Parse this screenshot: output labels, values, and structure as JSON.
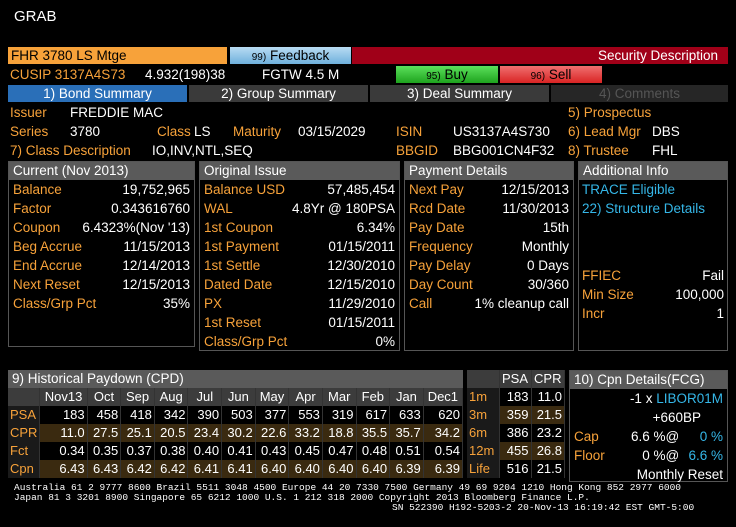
{
  "window": {
    "title": "GRAB"
  },
  "toolbar": {
    "ticker": "FHR 3780 LS Mtge",
    "feedback_num": "99)",
    "feedback_label": "Feedback",
    "security_description": "Security Description"
  },
  "line2": {
    "cusip": "CUSIP 3137A4S73",
    "coupon_info": "4.932(198)38",
    "fgtw": "FGTW 4.5 M",
    "buy_num": "95)",
    "buy_label": "Buy",
    "sell_num": "96)",
    "sell_label": "Sell"
  },
  "tabs": [
    {
      "label": "1) Bond Summary"
    },
    {
      "label": "2) Group Summary"
    },
    {
      "label": "3) Deal Summary"
    },
    {
      "label": "4) Comments"
    }
  ],
  "info": {
    "issuer_label": "Issuer",
    "issuer_value": "FREDDIE MAC",
    "series_label": "Series",
    "series_value": "3780",
    "class_label": "Class",
    "class_value": "LS",
    "maturity_label": "Maturity",
    "maturity_value": "03/15/2029",
    "isin_label": "ISIN",
    "isin_value": "US3137A4S730",
    "class_desc_label": "7) Class Description",
    "class_desc_value": "IO,INV,NTL,SEQ",
    "bbgid_label": "BBGID",
    "bbgid_value": "BBG001CN4F32",
    "prospectus": "5) Prospectus",
    "lead_mgr_label": "6) Lead Mgr",
    "lead_mgr_value": "DBS",
    "trustee_label": "8) Trustee",
    "trustee_value": "FHL"
  },
  "current": {
    "title": "Current (Nov 2013)",
    "rows": [
      {
        "label": "Balance",
        "value": "19,752,965"
      },
      {
        "label": "Factor",
        "value": "0.343616760"
      },
      {
        "label": "Coupon",
        "value": "6.4323%(Nov '13)"
      },
      {
        "label": "Beg Accrue",
        "value": "11/15/2013"
      },
      {
        "label": "End Accrue",
        "value": "12/14/2013"
      },
      {
        "label": "Next Reset",
        "value": "12/15/2013"
      },
      {
        "label": "Class/Grp Pct",
        "value": "35%"
      }
    ]
  },
  "original": {
    "title": "Original Issue",
    "rows": [
      {
        "label": "Balance USD",
        "value": "57,485,454"
      },
      {
        "label": "WAL",
        "value": "4.8Yr @ 180PSA"
      },
      {
        "label": "1st Coupon",
        "value": "6.34%"
      },
      {
        "label": "1st Payment",
        "value": "01/15/2011"
      },
      {
        "label": "1st Settle",
        "value": "12/30/2010"
      },
      {
        "label": "Dated Date",
        "value": "12/15/2010"
      },
      {
        "label": "PX",
        "value": "11/29/2010"
      },
      {
        "label": "1st Reset",
        "value": "01/15/2011"
      },
      {
        "label": "Class/Grp Pct",
        "value": "0%"
      }
    ]
  },
  "payment": {
    "title": "Payment Details",
    "rows": [
      {
        "label": "Next Pay",
        "value": "12/15/2013"
      },
      {
        "label": "Rcd Date",
        "value": "11/30/2013"
      },
      {
        "label": "Pay Date",
        "value": "15th"
      },
      {
        "label": "Frequency",
        "value": "Monthly"
      },
      {
        "label": "Pay Delay",
        "value": "0 Days"
      },
      {
        "label": "Day Count",
        "value": "30/360"
      },
      {
        "label": "Call",
        "value": "1% cleanup call"
      }
    ]
  },
  "additional": {
    "title": "Additional Info",
    "trace": "TRACE Eligible",
    "structure": "22) Structure Details",
    "rows": [
      {
        "label": "FFIEC",
        "value": "Fail"
      },
      {
        "label": "Min Size",
        "value": "100,000"
      },
      {
        "label": "Incr",
        "value": "1"
      }
    ]
  },
  "paydown": {
    "title": "9) Historical Paydown (CPD)",
    "months": [
      "Nov13",
      "Oct",
      "Sep",
      "Aug",
      "Jul",
      "Jun",
      "May",
      "Apr",
      "Mar",
      "Feb",
      "Jan",
      "Dec1"
    ],
    "rows": [
      {
        "label": "PSA",
        "values": [
          "183",
          "458",
          "418",
          "342",
          "390",
          "503",
          "377",
          "553",
          "319",
          "617",
          "633",
          "620"
        ]
      },
      {
        "label": "CPR",
        "values": [
          "11.0",
          "27.5",
          "25.1",
          "20.5",
          "23.4",
          "30.2",
          "22.6",
          "33.2",
          "18.8",
          "35.5",
          "35.7",
          "34.2"
        ]
      },
      {
        "label": "Fct",
        "values": [
          "0.34",
          "0.35",
          "0.37",
          "0.38",
          "0.40",
          "0.41",
          "0.43",
          "0.45",
          "0.47",
          "0.48",
          "0.51",
          "0.54"
        ]
      },
      {
        "label": "Cpn",
        "values": [
          "6.43",
          "6.43",
          "6.42",
          "6.42",
          "6.41",
          "6.41",
          "6.40",
          "6.40",
          "6.40",
          "6.40",
          "6.39",
          "6.39"
        ]
      }
    ]
  },
  "speeds": {
    "headers": [
      "PSA",
      "CPR"
    ],
    "rows": [
      {
        "label": "1m",
        "psa": "183",
        "cpr": "11.0"
      },
      {
        "label": "3m",
        "psa": "359",
        "cpr": "21.5"
      },
      {
        "label": "6m",
        "psa": "386",
        "cpr": "23.2"
      },
      {
        "label": "12m",
        "psa": "455",
        "cpr": "26.8"
      },
      {
        "label": "Life",
        "psa": "516",
        "cpr": "21.5"
      }
    ]
  },
  "cpn": {
    "title": "10) Cpn Details(FCG)",
    "formula_prefix": "-1 x",
    "formula_index": "LIBOR01M",
    "spread": "+660BP",
    "cap_label": "Cap",
    "cap_value": "6.6 %@",
    "cap_at": "0 %",
    "floor_label": "Floor",
    "floor_value": "0 %@",
    "floor_at": "6.6 %",
    "reset": "Monthly Reset"
  },
  "footer": {
    "line1": "Australia 61 2 9777 8600 Brazil 5511 3048 4500 Europe 44 20 7330 7500 Germany 49 69 9204 1210 Hong Kong 852 2977 6000",
    "line2": "Japan 81 3 3201 8900          Singapore 65 6212 1000          U.S. 1 212 318 2000          Copyright 2013 Bloomberg Finance L.P.",
    "line3": "SN 522390 H192-5203-2 20-Nov-13 16:19:42 EST  GMT-5:00"
  }
}
